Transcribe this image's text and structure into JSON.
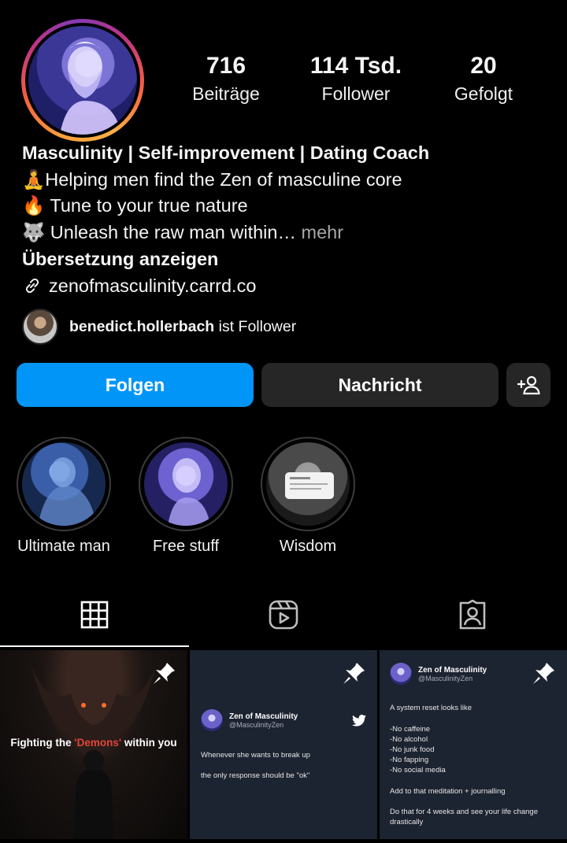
{
  "profile": {
    "stats": [
      {
        "value": "716",
        "label": "Beiträge"
      },
      {
        "value": "114 Tsd.",
        "label": "Follower"
      },
      {
        "value": "20",
        "label": "Gefolgt"
      }
    ],
    "bio": {
      "name_line": "Masculinity | Self-improvement | Dating Coach",
      "line1": "🧘Helping men find the Zen of masculine core",
      "line2": "🔥 Tune to your true nature",
      "line3": "🐺 Unleash the raw man within…",
      "more": " mehr",
      "translate": "Übersetzung anzeigen",
      "link": "zenofmasculinity.carrd.co"
    },
    "followed_by": {
      "username": "benedict.hollerbach",
      "suffix": " ist Follower"
    }
  },
  "actions": {
    "follow": "Folgen",
    "message": "Nachricht",
    "add_icon": "add-person-icon"
  },
  "highlights": [
    {
      "label": "Ultimate man"
    },
    {
      "label": "Free stuff"
    },
    {
      "label": "Wisdom"
    }
  ],
  "tabs": [
    "grid-icon",
    "reels-icon",
    "tagged-icon"
  ],
  "posts": {
    "post1": {
      "text_pre": "Fighting the ",
      "text_accent": "'Demons'",
      "text_post": " within you",
      "accent_color": "#e0453a"
    },
    "post2": {
      "name": "Zen of Masculinity",
      "handle": "@MasculinityZen",
      "line1": "Whenever she wants to break up",
      "line2": "the only response should be \"ok\""
    },
    "post3": {
      "name": "Zen of Masculinity",
      "handle": "@MasculinityZen",
      "intro": "A system reset looks like",
      "items": [
        "-No caffeine",
        "-No alcohol",
        "-No junk food",
        "-No fapping",
        "-No social media"
      ],
      "line_a": "Add to that meditation + journalling",
      "line_b": "Do that for 4 weeks and see your life change drastically"
    }
  },
  "colors": {
    "follow_button": "#0095f6",
    "secondary_button": "#262626",
    "background": "#000000"
  }
}
